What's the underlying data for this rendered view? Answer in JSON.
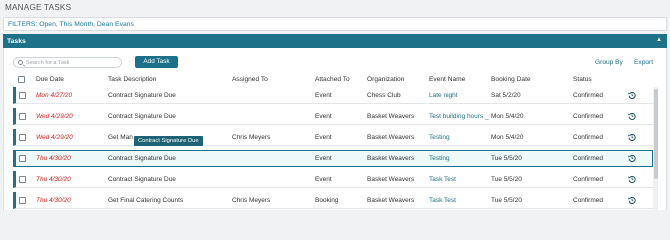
{
  "page": {
    "title": "MANAGE TASKS"
  },
  "filters": {
    "label": "FILTERS: Open, This Month, Dean Evans"
  },
  "panel": {
    "title": "Tasks",
    "caret": "▲"
  },
  "toolbar": {
    "search_placeholder": "Search for a Task",
    "add_label": "Add Task",
    "group_by_label": "Group By",
    "export_label": "Export"
  },
  "columns": {
    "due_date": "Due Date",
    "description": "Task Description",
    "assigned_to": "Assigned To",
    "attached_to": "Attached To",
    "organization": "Organization",
    "event_name": "Event Name",
    "booking_date": "Booking Date",
    "status": "Status"
  },
  "rows": [
    {
      "due": "Mon 4/27/20",
      "desc": "Contract Signature Due",
      "assigned": "",
      "attached": "Event",
      "org": "Chess Club",
      "event": "Late night",
      "booking": "Sat 5/2/20",
      "status": "Confirmed"
    },
    {
      "due": "Wed 4/29/20",
      "desc": "Contract Signature Due",
      "assigned": "",
      "attached": "Event",
      "org": "Basket Weavers",
      "event": "Test building hours _",
      "booking": "Mon 5/4/20",
      "status": "Confirmed"
    },
    {
      "due": "Wed 4/29/20",
      "desc": "Get Man",
      "assigned": "Chris Meyers",
      "attached": "Event",
      "org": "Basket Weavers",
      "event": "Testing",
      "booking": "Mon 5/4/20",
      "status": "Confirmed"
    },
    {
      "due": "Thu 4/30/20",
      "desc": "Contract Signature Due",
      "assigned": "",
      "attached": "Event",
      "org": "Basket Weavers",
      "event": "Testing",
      "booking": "Tue 5/5/20",
      "status": "Confirmed"
    },
    {
      "due": "Thu 4/30/20",
      "desc": "Contract Signature Due",
      "assigned": "",
      "attached": "Event",
      "org": "Basket Weavers",
      "event": "Task Test",
      "booking": "Tue 5/5/20",
      "status": "Confirmed"
    },
    {
      "due": "Thu 4/30/20",
      "desc": "Get Final Catering Counts",
      "assigned": "Chris Meyers",
      "attached": "Booking",
      "org": "Basket Weavers",
      "event": "Task Test",
      "booking": "Tue 5/5/20",
      "status": "Confirmed"
    }
  ],
  "tooltip": {
    "text": "Contract Signature Due"
  },
  "colors": {
    "accent": "#1d7189",
    "due_date": "#d9251c",
    "highlight_row": "#eef9f9"
  }
}
